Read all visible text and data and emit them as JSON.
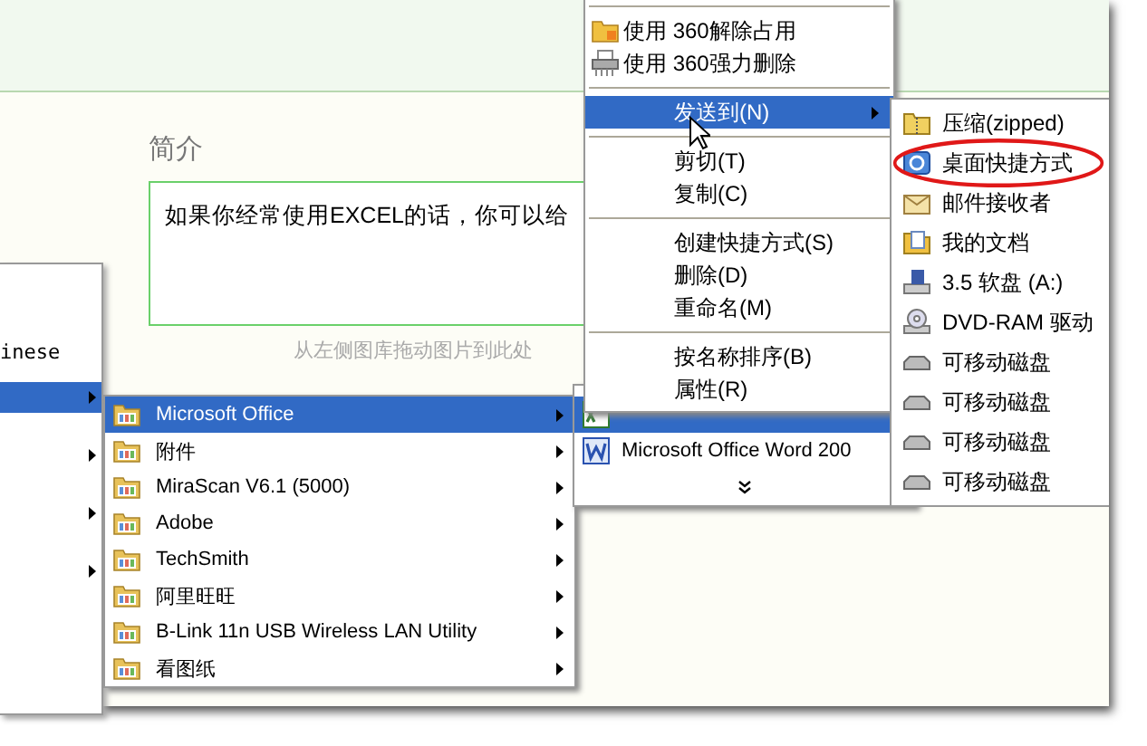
{
  "page": {
    "section_label": "简介",
    "description_value": "如果你经常使用EXCEL的话，你可以给",
    "image_hint": "从左侧图库拖动图片到此处"
  },
  "start_menu": {
    "items": [
      {
        "label": "inese",
        "selected": false,
        "has_submenu": false
      },
      {
        "selected": true,
        "has_submenu": true
      },
      {
        "selected": false,
        "has_submenu": true
      },
      {
        "selected": false,
        "has_submenu": true
      },
      {
        "selected": false,
        "has_submenu": true
      }
    ]
  },
  "programs_menu": {
    "items": [
      {
        "label": "Microsoft Office",
        "selected": true
      },
      {
        "label": "附件",
        "selected": false
      },
      {
        "label": "MiraScan V6.1 (5000)",
        "selected": false
      },
      {
        "label": "Adobe",
        "selected": false
      },
      {
        "label": "TechSmith",
        "selected": false
      },
      {
        "label": "阿里旺旺",
        "selected": false
      },
      {
        "label": "B-Link 11n USB Wireless LAN Utility",
        "selected": false
      },
      {
        "label": "看图纸",
        "selected": false
      }
    ]
  },
  "office_menu": {
    "items": [
      {
        "kind": "excel",
        "selected": true
      },
      {
        "kind": "word",
        "label": "Microsoft Office Word 200",
        "selected": false
      },
      {
        "kind": "more",
        "selected": false
      }
    ]
  },
  "context_menu": {
    "items": [
      {
        "kind": "separator"
      },
      {
        "kind": "folder",
        "label": "使用 360解除占用",
        "selected": false,
        "has_submenu": false
      },
      {
        "kind": "shredder",
        "label": "使用 360强力删除",
        "selected": false,
        "has_submenu": false
      },
      {
        "kind": "separator"
      },
      {
        "kind": "item",
        "label": "发送到(N)",
        "selected": true,
        "has_submenu": true
      },
      {
        "kind": "separator"
      },
      {
        "kind": "item",
        "label": "剪切(T)",
        "selected": false,
        "has_submenu": false
      },
      {
        "kind": "item",
        "label": "复制(C)",
        "selected": false,
        "has_submenu": false
      },
      {
        "kind": "separator"
      },
      {
        "kind": "item",
        "label": "创建快捷方式(S)",
        "selected": false,
        "has_submenu": false
      },
      {
        "kind": "item",
        "label": "删除(D)",
        "selected": false,
        "has_submenu": false
      },
      {
        "kind": "item",
        "label": "重命名(M)",
        "selected": false,
        "has_submenu": false
      },
      {
        "kind": "separator"
      },
      {
        "kind": "item",
        "label": "按名称排序(B)",
        "selected": false,
        "has_submenu": false
      },
      {
        "kind": "item",
        "label": "属性(R)",
        "selected": false,
        "has_submenu": false
      }
    ]
  },
  "send_to_menu": {
    "items": [
      {
        "kind": "zip",
        "label": "压缩(zipped)",
        "circled": false
      },
      {
        "kind": "desktop",
        "label": "桌面快捷方式",
        "circled": true
      },
      {
        "kind": "mail",
        "label": "邮件接收者",
        "circled": false
      },
      {
        "kind": "documents",
        "label": "我的文档",
        "circled": false
      },
      {
        "kind": "floppy",
        "label": "3.5 软盘 (A:)",
        "circled": false
      },
      {
        "kind": "dvd",
        "label": "DVD-RAM 驱动",
        "circled": false
      },
      {
        "kind": "drive",
        "label": "可移动磁盘",
        "circled": false
      },
      {
        "kind": "drive",
        "label": "可移动磁盘",
        "circled": false
      },
      {
        "kind": "drive",
        "label": "可移动磁盘",
        "circled": false
      },
      {
        "kind": "drive",
        "label": "可移动磁盘",
        "circled": false
      }
    ]
  }
}
